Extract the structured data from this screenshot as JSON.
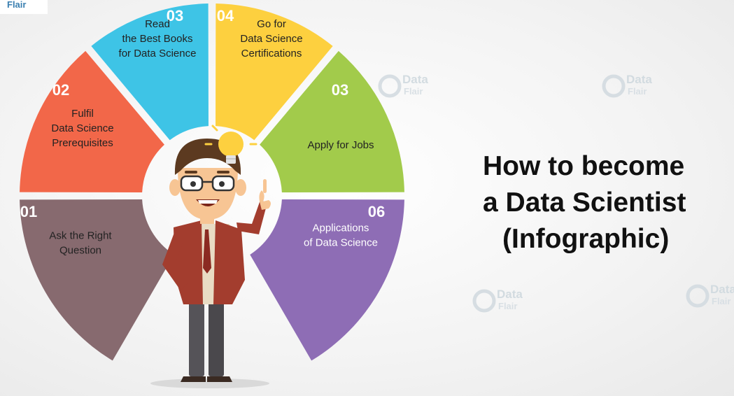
{
  "title": {
    "line1": "How to become",
    "line2": "a Data Scientist",
    "line3": "(Infographic)"
  },
  "brand": {
    "logo_top": "Flair",
    "watermark_main": "Data",
    "watermark_sub": "Flair"
  },
  "segments": [
    {
      "number": "01",
      "lines": [
        "Ask the Right",
        "Question"
      ],
      "color": "#876a6f"
    },
    {
      "number": "02",
      "lines": [
        "Fulfil",
        "Data Science",
        "Prerequisites"
      ],
      "color": "#f26749"
    },
    {
      "number": "03",
      "lines": [
        "Read",
        "the Best Books",
        "for Data Science"
      ],
      "color": "#3ec4e6"
    },
    {
      "number": "04",
      "lines": [
        "Go for",
        "Data Science",
        "Certifications"
      ],
      "color": "#fdd03f"
    },
    {
      "number": "03",
      "lines": [
        "Apply for Jobs"
      ],
      "color": "#a2cb4b"
    },
    {
      "number": "06",
      "lines": [
        "Applications",
        "of Data Science"
      ],
      "color": "#8e6db5"
    }
  ],
  "character": {
    "shirt_color": "#a33d2e",
    "hair_color": "#5c3a20",
    "bulb_color": "#fdd03f"
  }
}
